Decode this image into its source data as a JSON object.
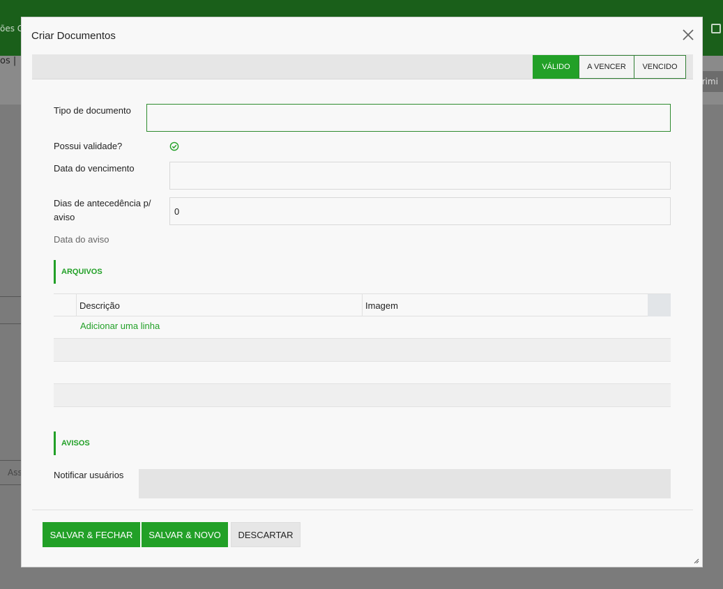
{
  "background": {
    "topbar_left_text": "ões G",
    "title_fragment": "os |",
    "print_fragment": "primi",
    "side_label": "Ass"
  },
  "modal": {
    "title": "Criar Documentos",
    "status_buttons": [
      {
        "label": "VÁLIDO",
        "active": true
      },
      {
        "label": "A VENCER",
        "active": false
      },
      {
        "label": "VENCIDO",
        "active": false
      }
    ],
    "fields": {
      "tipo_label": "Tipo de documento",
      "tipo_value": "",
      "validade_label": "Possui validade?",
      "validade_checked": true,
      "vencimento_label": "Data do vencimento",
      "vencimento_value": "",
      "antecedencia_label": "Dias de antecedência p/ aviso",
      "antecedencia_value": "0",
      "aviso_label": "Data do aviso"
    },
    "sections": {
      "arquivos": "ARQUIVOS",
      "avisos": "AVISOS"
    },
    "table": {
      "columns": [
        "Descrição",
        "Imagem"
      ],
      "add_line": "Adicionar uma linha"
    },
    "notificar_label": "Notificar usuários",
    "footer": {
      "save_close": "SALVAR & FECHAR",
      "save_new": "SALVAR & NOVO",
      "discard": "DESCARTAR"
    }
  },
  "colors": {
    "accent": "#22a027",
    "topbar": "#1a5f1a"
  }
}
